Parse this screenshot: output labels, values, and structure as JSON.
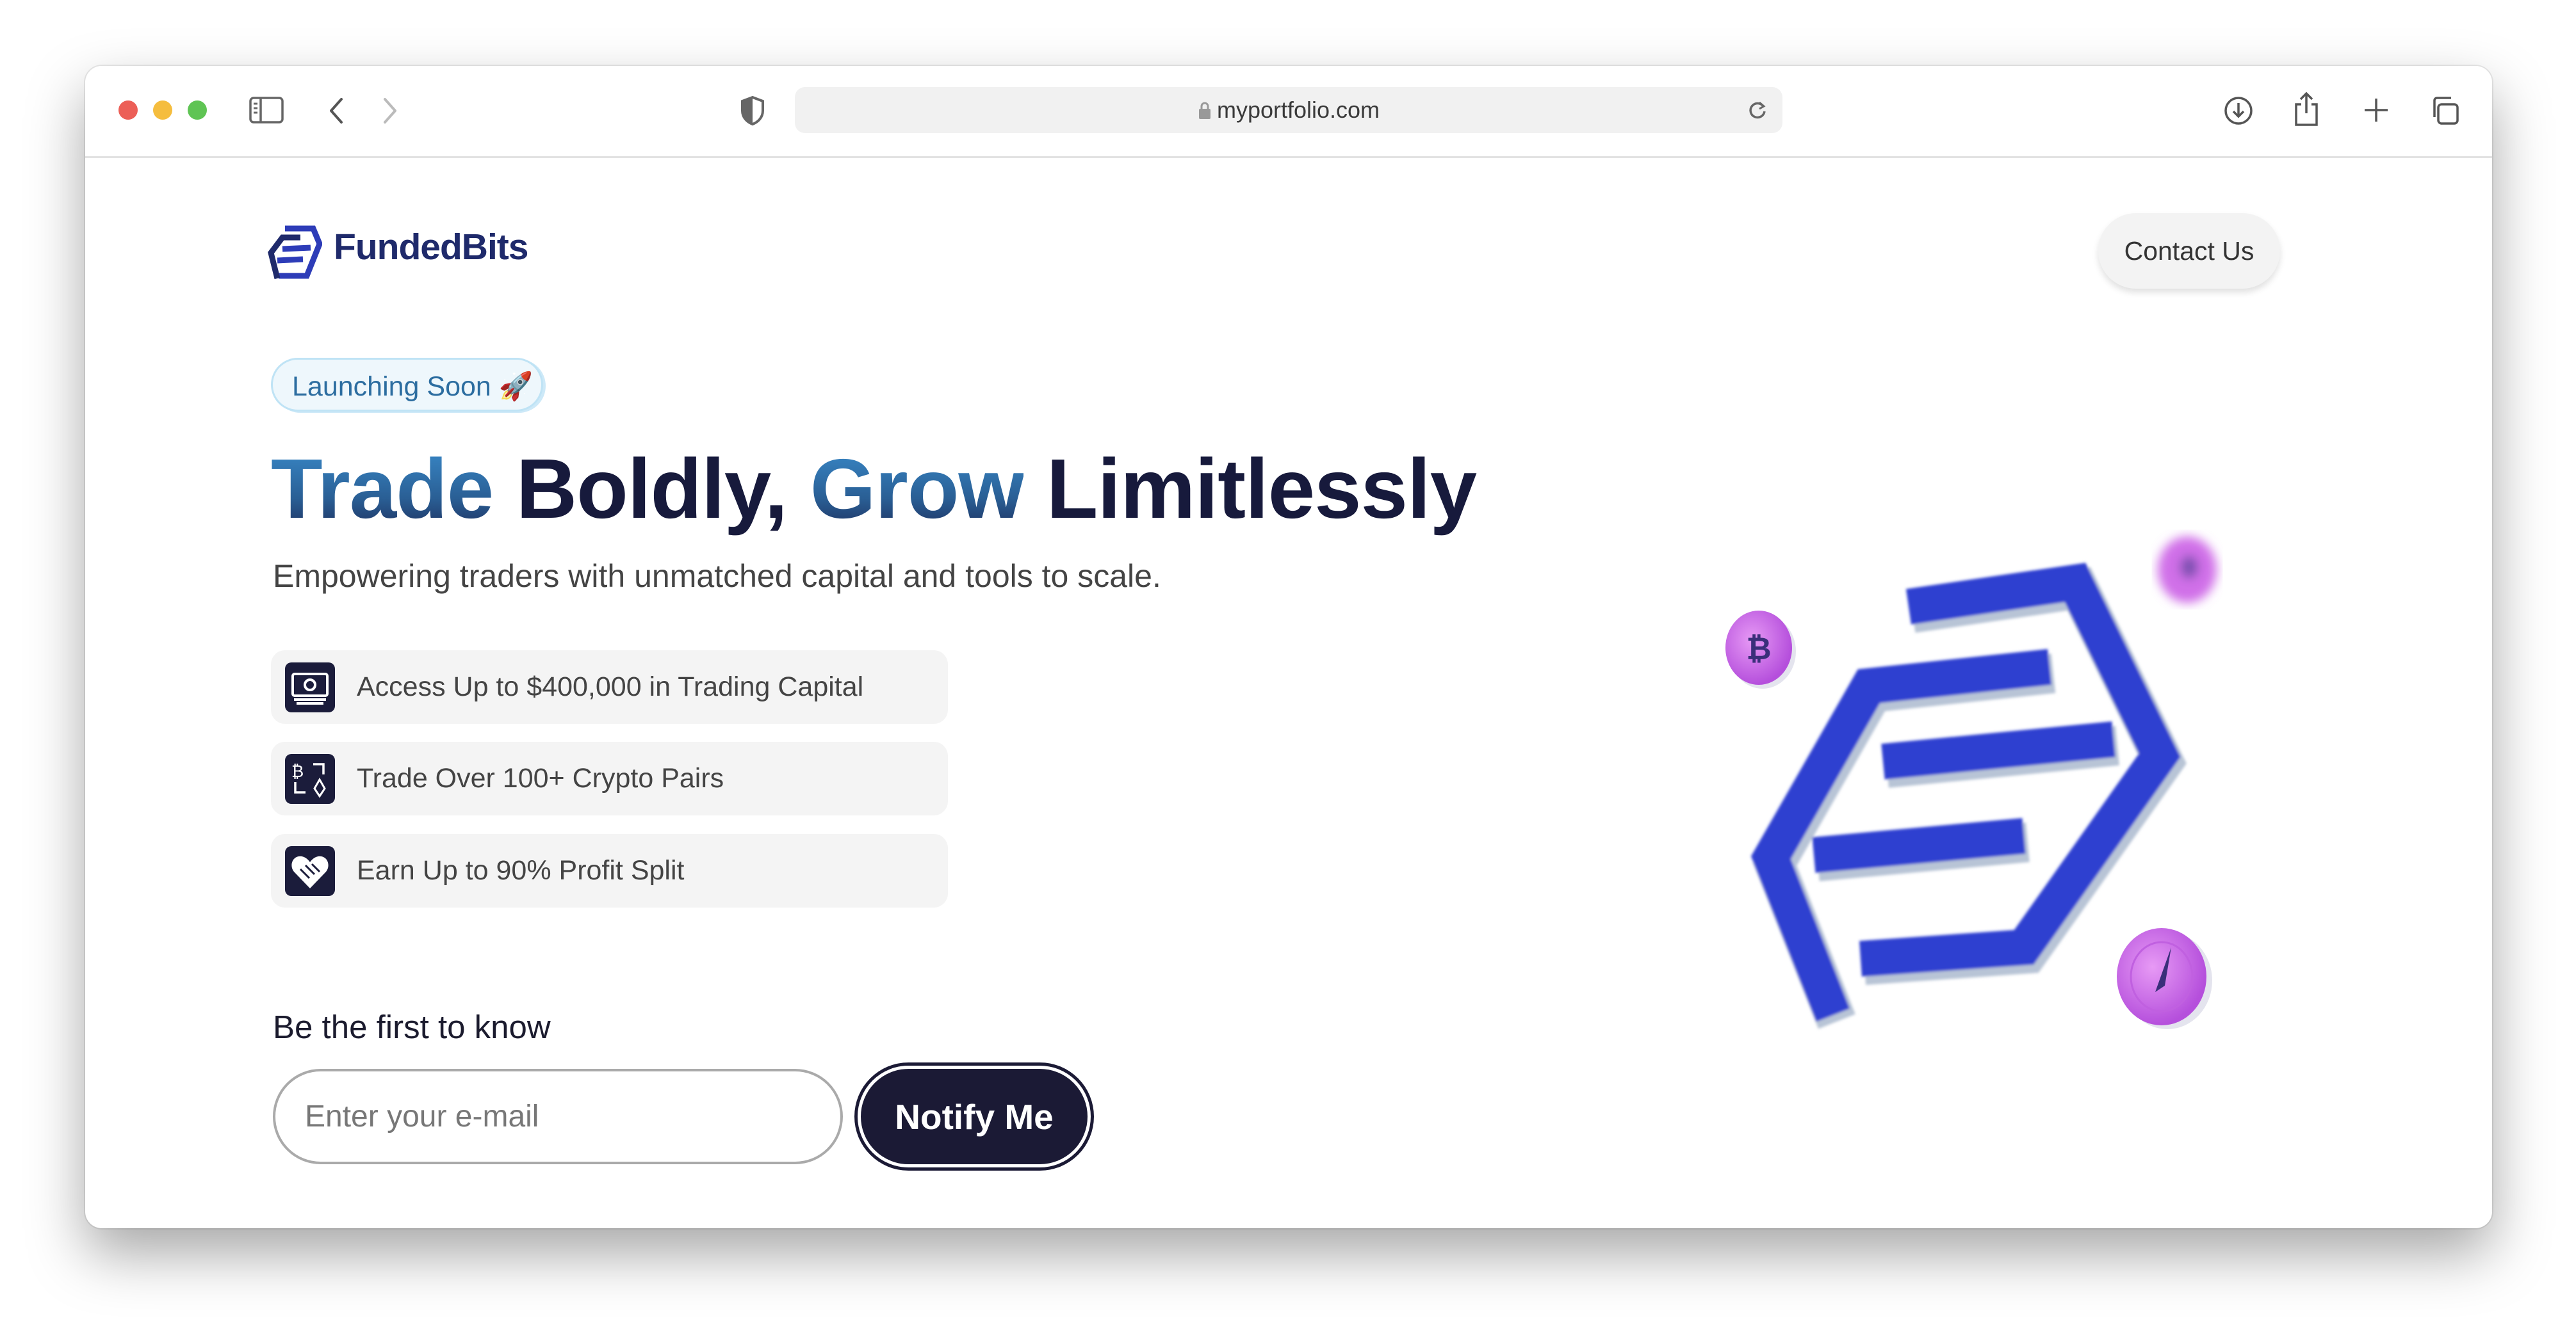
{
  "browser": {
    "url": "myportfolio.com",
    "icons": [
      "sidebar-icon",
      "back-icon",
      "forward-icon",
      "shield-icon",
      "lock-icon",
      "reload-icon",
      "download-icon",
      "share-icon",
      "new-tab-icon",
      "tabs-overview-icon"
    ]
  },
  "header": {
    "logo_text": "FundedBits",
    "contact_label": "Contact Us"
  },
  "hero": {
    "badge": "Launching Soon 🚀",
    "headline": {
      "part1": "Trade",
      "part2": " Boldly, ",
      "part3": "Grow",
      "part4": " Limitlessly"
    },
    "subtitle": "Empowering traders with unmatched capital and tools to scale.",
    "features": [
      {
        "icon": "money-icon",
        "label": "Access Up to $400,000 in Trading Capital"
      },
      {
        "icon": "crypto-exchange-icon",
        "label": "Trade Over 100+ Crypto Pairs"
      },
      {
        "icon": "handshake-heart-icon",
        "label": "Earn Up to 90% Profit Split"
      }
    ],
    "notify_label": "Be the first to know",
    "email_placeholder": "Enter your e-mail",
    "email_value": "",
    "notify_button": "Notify Me"
  },
  "colors": {
    "brand_dark": "#1b1a35",
    "brand_blue": "#2f3fd0",
    "accent_gradient_blue": "#3a8ccc",
    "coin_pink": "#d070e8"
  }
}
